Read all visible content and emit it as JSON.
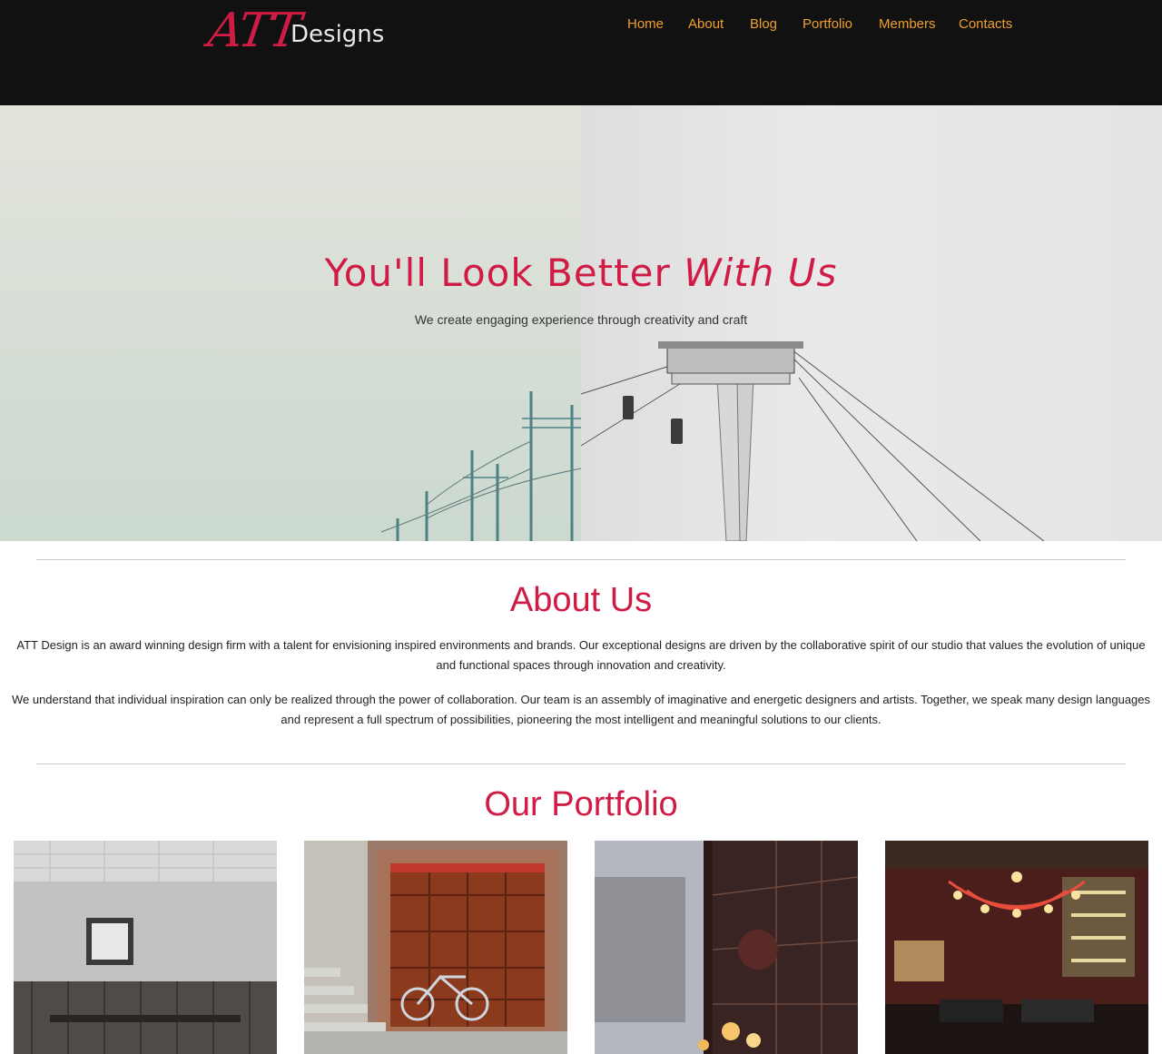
{
  "brand": {
    "logo_primary": "ATT",
    "logo_secondary": "Designs"
  },
  "nav": {
    "items": [
      {
        "label": "Home"
      },
      {
        "label": "About"
      },
      {
        "label": "Blog"
      },
      {
        "label": "Portfolio"
      },
      {
        "label": "Members"
      },
      {
        "label": "Contacts"
      }
    ]
  },
  "hero": {
    "title_regular": "You'll Look Better",
    "title_italic": "With Us",
    "subtitle": "We create engaging experience through creativity and craft"
  },
  "about": {
    "title": "About Us",
    "paragraph_1": "ATT Design is an award winning design firm with a talent for envisioning inspired environments and brands. Our exceptional designs are driven by the collaborative spirit of our studio that values the evolution of unique and functional spaces through innovation and creativity.",
    "paragraph_2": "We understand that individual inspiration can only be realized through the power of collaboration. Our team is an assembly of imaginative and energetic designers and artists. Together, we speak many design languages and represent a full spectrum of possibilities, pioneering the most intelligent and meaningful solutions to our clients."
  },
  "portfolio": {
    "title": "Our Portfolio"
  },
  "colors": {
    "accent": "#d01c45",
    "nav_link": "#f0a02a",
    "header_bg": "#111111"
  }
}
